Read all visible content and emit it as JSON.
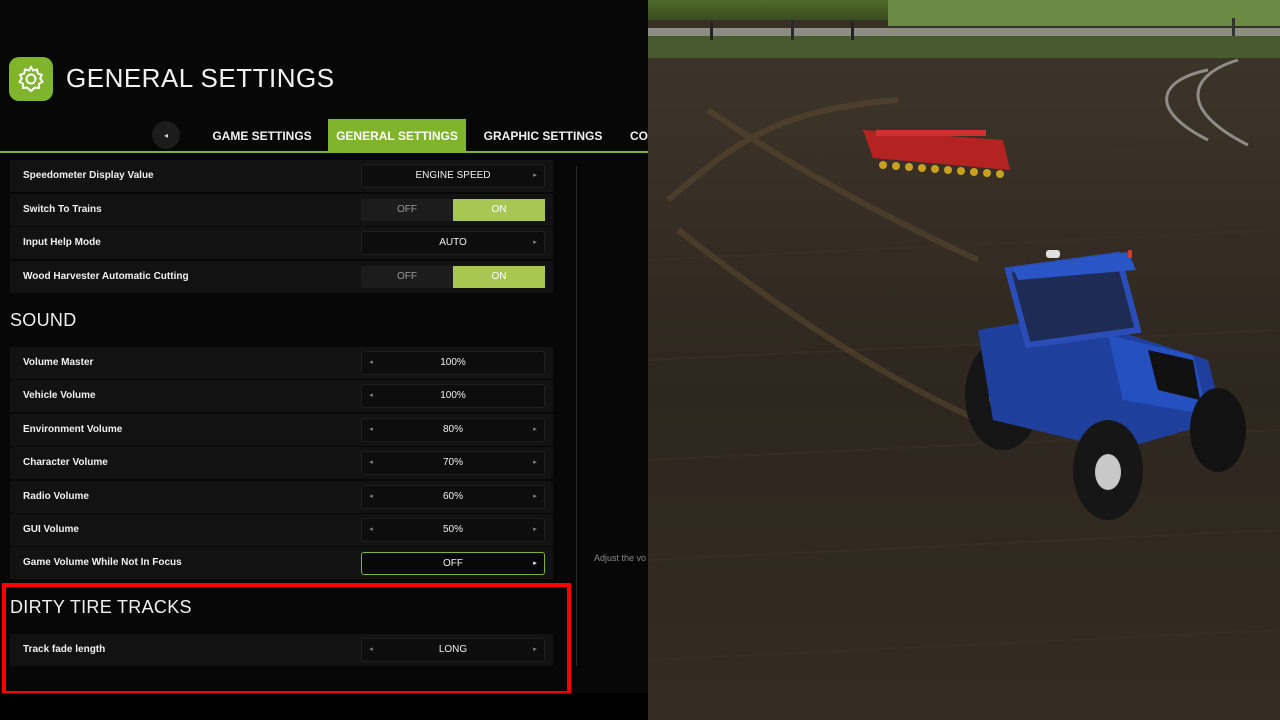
{
  "header": {
    "title": "GENERAL SETTINGS",
    "icon": "gear-icon"
  },
  "tabs": {
    "back_icon": "◂",
    "items": [
      {
        "label": "GAME SETTINGS",
        "active": false
      },
      {
        "label": "GENERAL SETTINGS",
        "active": true
      },
      {
        "label": "GRAPHIC SETTINGS",
        "active": false
      },
      {
        "label": "CO",
        "active": false
      }
    ]
  },
  "arrows": {
    "left": "◂",
    "right": "▸"
  },
  "general": {
    "speedometer": {
      "label": "Speedometer Display Value",
      "value": "ENGINE SPEED"
    },
    "switch_trains": {
      "label": "Switch To Trains",
      "off": "OFF",
      "on": "ON",
      "selected": "ON"
    },
    "input_help": {
      "label": "Input Help Mode",
      "value": "AUTO"
    },
    "wood_harvester": {
      "label": "Wood Harvester Automatic Cutting",
      "off": "OFF",
      "on": "ON",
      "selected": "ON"
    }
  },
  "sound": {
    "title": "SOUND",
    "volume_master": {
      "label": "Volume Master",
      "value": "100%"
    },
    "vehicle_volume": {
      "label": "Vehicle Volume",
      "value": "100%"
    },
    "environment_volume": {
      "label": "Environment Volume",
      "value": "80%"
    },
    "character_volume": {
      "label": "Character Volume",
      "value": "70%"
    },
    "radio_volume": {
      "label": "Radio Volume",
      "value": "60%"
    },
    "gui_volume": {
      "label": "GUI Volume",
      "value": "50%"
    },
    "game_volume_unfocused": {
      "label": "Game Volume While Not In Focus",
      "value": "OFF"
    }
  },
  "tire_tracks": {
    "title": "DIRTY TIRE TRACKS",
    "track_fade": {
      "label": "Track fade length",
      "value": "LONG"
    }
  },
  "help_text": "Adjust the vo",
  "colors": {
    "accent": "#7fb42c",
    "toggle_selected": "#a8c752",
    "highlight": "#ff0000"
  }
}
